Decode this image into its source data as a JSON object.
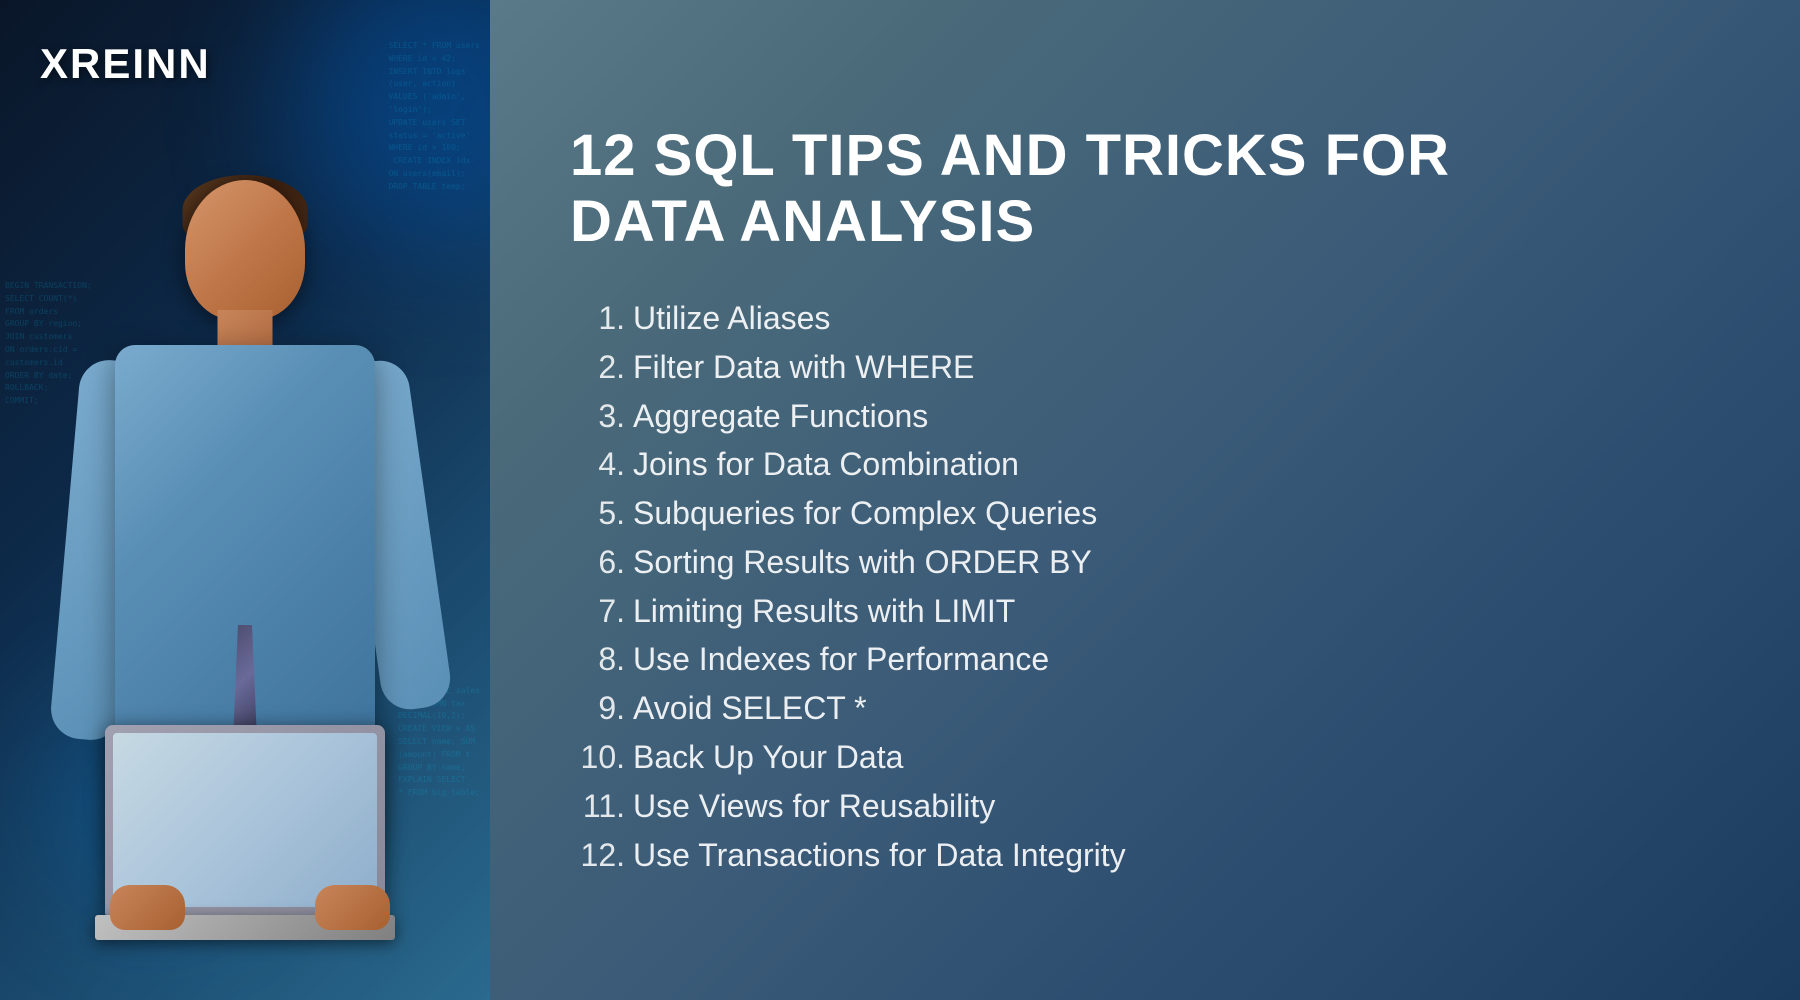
{
  "brand": {
    "logo": "XREINN"
  },
  "title": {
    "line1": "12 SQL TIPS AND TRICKS FOR",
    "line2": "DATA ANALYSIS"
  },
  "tips": [
    {
      "number": "1.",
      "text": "Utilize Aliases"
    },
    {
      "number": "2.",
      "text": "Filter Data with WHERE"
    },
    {
      "number": "3.",
      "text": "Aggregate Functions"
    },
    {
      "number": "4.",
      "text": "Joins for Data Combination"
    },
    {
      "number": "5.",
      "text": "Subqueries for Complex Queries"
    },
    {
      "number": "6.",
      "text": "Sorting Results with ORDER BY"
    },
    {
      "number": "7.",
      "text": "Limiting Results with LIMIT"
    },
    {
      "number": "8.",
      "text": "Use Indexes for Performance"
    },
    {
      "number": "9.",
      "text": "Avoid SELECT *"
    },
    {
      "number": "10.",
      "text": "Back Up Your Data"
    },
    {
      "number": "11.",
      "text": "Use Views for Reusability"
    },
    {
      "number": "12.",
      "text": "Use Transactions for Data Integrity"
    }
  ],
  "deco": {
    "code1": "SELECT * FROM users\nWHERE id = 42;\nINSERT INTO logs\n(user, action)\nVALUES ('admin',\n'login');\nUPDATE users SET\nstatus = 'active'\nWHERE id > 100;\n CREATE INDEX idx\nON users(email);\nDROP TABLE temp;",
    "code2": "BEGIN TRANSACTION;\nSELECT COUNT(*)\nFROM orders\nGROUP BY region;\nJOIN customers\nON orders.cid =\ncustomers.id\nORDER BY date;\nROLLBACK;\nCOMMIT;",
    "code3": "ALTER TABLE sales\nADD COLUMN tax\nDECIMAL(10,2);\nCREATE VIEW v AS\nSELECT name, SUM\n(amount) FROM t\nGROUP BY name;\nEXPLAIN SELECT\n* FROM big_table;"
  }
}
